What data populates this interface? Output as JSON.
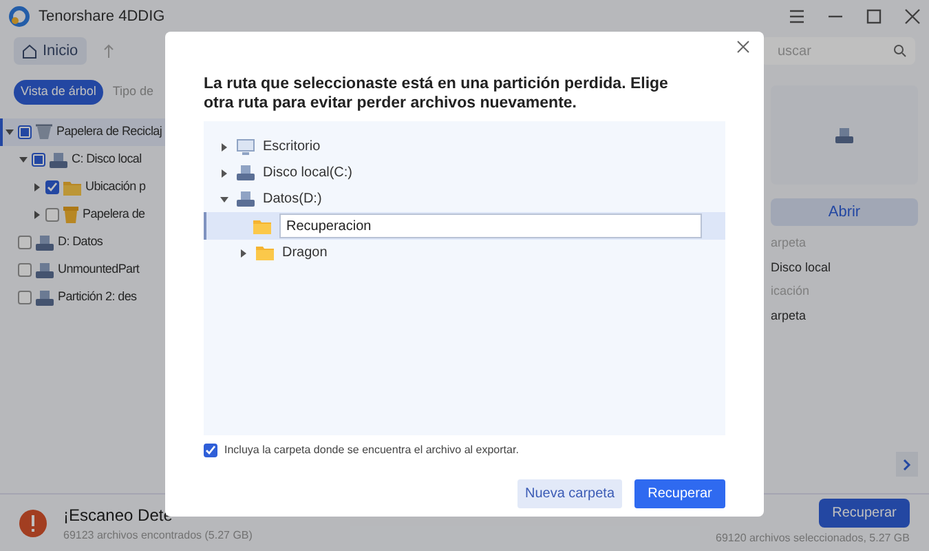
{
  "window": {
    "title": "Tenorshare 4DDIG"
  },
  "toolbar": {
    "home": "Inicio",
    "search": {
      "placeholder": "uscar"
    }
  },
  "view_tabs": [
    {
      "label": "Vista de árbol",
      "selected": true
    },
    {
      "label": "Tipo de",
      "selected": false
    }
  ],
  "tree": [
    {
      "label": "Papelera de Reciclaj",
      "kind": "recycle",
      "checked": false,
      "partial": true,
      "expanded": true,
      "selected": true,
      "children": [
        {
          "label": "C: Disco local",
          "kind": "drive",
          "checked": false,
          "partial": true,
          "expanded": true,
          "selected": false,
          "children": [
            {
              "label": "Ubicación p",
              "kind": "folder",
              "checked": true,
              "partial": false,
              "expanded": false,
              "selected": false
            },
            {
              "label": "Papelera de",
              "kind": "bin",
              "checked": false,
              "partial": false,
              "expanded": false,
              "selected": false
            }
          ]
        }
      ]
    },
    {
      "label": "D: Datos",
      "kind": "drive",
      "checked": false,
      "partial": false,
      "selected": false
    },
    {
      "label": "UnmountedPart",
      "kind": "drive",
      "checked": false,
      "partial": false,
      "selected": false
    },
    {
      "label": "Partición 2: des",
      "kind": "drive",
      "checked": false,
      "partial": false,
      "selected": false
    }
  ],
  "details": {
    "open_button": "Abrir",
    "fields": [
      "arpeta",
      "Disco local",
      "icación",
      "arpeta"
    ]
  },
  "status": {
    "title": "¡Escaneo Dete",
    "found": "69123 archivos encontrados (5.27 GB)",
    "recover_button": "Recuperar",
    "selected": "69120 archivos seleccionados, 5.27 GB"
  },
  "dialog": {
    "message": "La ruta que seleccionaste está en una partición perdida. Elige otra ruta para evitar perder archivos nuevamente.",
    "tree": [
      {
        "label": "Escritorio",
        "kind": "desktop",
        "expanded": false
      },
      {
        "label": "Disco local(C:)",
        "kind": "drive",
        "expanded": false
      },
      {
        "label": "Datos(D:)",
        "kind": "drive",
        "expanded": true,
        "children": [
          {
            "label": "Recuperacion",
            "kind": "folder",
            "editing": true
          },
          {
            "label": "Dragon",
            "kind": "folder",
            "expanded": false
          }
        ]
      }
    ],
    "include_folder": {
      "label": "Incluya la carpeta donde se encuentra el archivo al exportar.",
      "checked": true
    },
    "buttons": [
      {
        "label": "Nueva carpeta",
        "kind": "secondary"
      },
      {
        "label": "Recuperar",
        "kind": "primary"
      }
    ]
  }
}
